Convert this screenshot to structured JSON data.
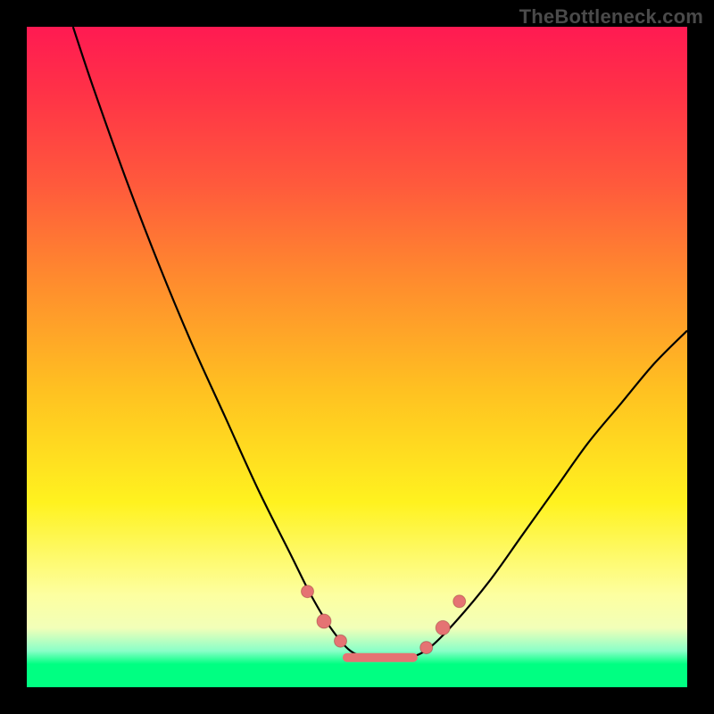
{
  "watermark": "TheBottleneck.com",
  "chart_data": {
    "type": "line",
    "title": "",
    "xlabel": "",
    "ylabel": "",
    "xlim": [
      0,
      100
    ],
    "ylim": [
      0,
      100
    ],
    "grid": false,
    "series": [
      {
        "name": "bottleneck-curve",
        "x": [
          7,
          10,
          15,
          20,
          25,
          30,
          35,
          40,
          43,
          46,
          49,
          52,
          55,
          58,
          61,
          65,
          70,
          75,
          80,
          85,
          90,
          95,
          100
        ],
        "values": [
          100,
          91,
          77,
          64,
          52,
          41,
          30,
          20,
          14,
          9,
          5.5,
          4.5,
          4.5,
          4.5,
          6,
          10,
          16,
          23,
          30,
          37,
          43,
          49,
          54
        ]
      }
    ],
    "markers": {
      "name": "highlight-points",
      "x": [
        42.5,
        45,
        47.5,
        60.5,
        63,
        65.5
      ],
      "values": [
        14.5,
        10,
        7,
        6,
        9,
        13
      ],
      "radius": [
        7,
        8,
        7,
        7,
        8,
        7
      ]
    },
    "flat_band": {
      "x_start": 48.5,
      "x_end": 58.5,
      "y": 4.5
    },
    "background_gradient": {
      "stops": [
        {
          "pos": 0.0,
          "color": "#ff1a52",
          "meaning": "worst"
        },
        {
          "pos": 0.55,
          "color": "#ffc121",
          "meaning": "mid"
        },
        {
          "pos": 0.96,
          "color": "#00ff82",
          "meaning": "best"
        }
      ]
    }
  }
}
